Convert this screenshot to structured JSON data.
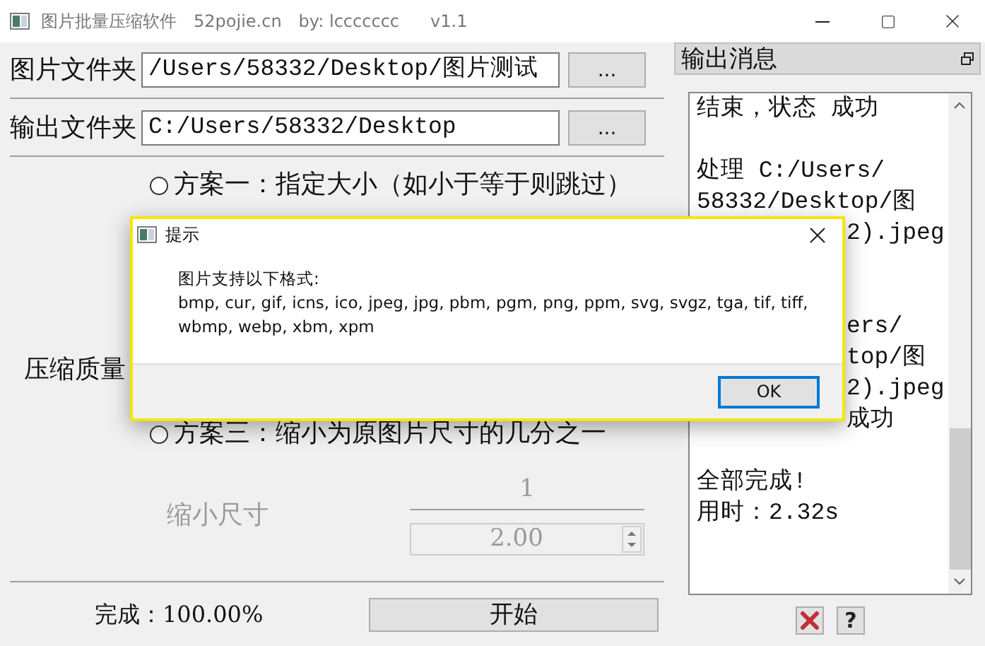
{
  "window": {
    "title_parts": [
      "图片批量压缩软件",
      "52pojie.cn",
      "by: lccccccc",
      "v1.1"
    ]
  },
  "folders": [
    {
      "label": "图片文件夹",
      "value": "/Users/58332/Desktop/图片测试",
      "button": "..."
    },
    {
      "label": "输出文件夹",
      "value": "C:/Users/58332/Desktop",
      "button": "..."
    }
  ],
  "option_1": {
    "label": "方案一：指定大小（如小于等于则跳过）",
    "selected": false
  },
  "quality_label": "压缩质量",
  "option_3": {
    "label": "方案三：缩小为原图片尺寸的几分之一",
    "selected": false
  },
  "scale": {
    "label": "缩小尺寸",
    "numerator": "1",
    "value": "2.00",
    "disabled": true
  },
  "progress": "完成：100.00%",
  "start_button": "开始",
  "output_panel": {
    "title": "输出消息",
    "lines": [
      {
        "kind": "full",
        "text": "结束，状态 成功"
      },
      {
        "kind": "gap"
      },
      {
        "kind": "full",
        "text": "处理 C:/Users/"
      },
      {
        "kind": "full",
        "text": "58332/Desktop/图"
      },
      {
        "kind": "tail",
        "text": "2).jpeg"
      },
      {
        "kind": "gap"
      },
      {
        "kind": "gap"
      },
      {
        "kind": "tail",
        "text": "ers/"
      },
      {
        "kind": "tail",
        "text": "top/图"
      },
      {
        "kind": "tail",
        "text": "2).jpeg"
      },
      {
        "kind": "tail",
        "text": "成功"
      },
      {
        "kind": "gap"
      },
      {
        "kind": "full",
        "text": "全部完成!"
      },
      {
        "kind": "full",
        "text": "用时：2.32s"
      }
    ]
  },
  "help_button": "?",
  "dialog": {
    "title": "提示",
    "heading": "图片支持以下格式:",
    "formats": "bmp, cur, gif, icns, ico, jpeg, jpg, pbm, pgm, png, ppm, svg, svgz, tga, tif, tiff, wbmp, webp, xbm, xpm",
    "ok_button": "OK"
  }
}
